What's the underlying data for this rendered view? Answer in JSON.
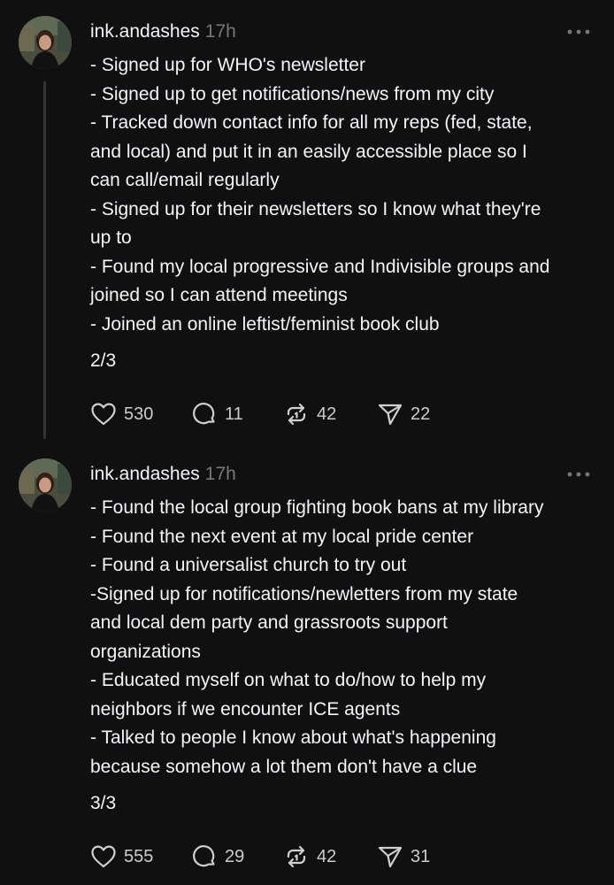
{
  "posts": [
    {
      "username": "ink.andashes",
      "timestamp": "17h",
      "text": "- Signed up for WHO's newsletter\n- Signed up to get notifications/news from my city\n- Tracked down contact info for all my reps (fed, state,\nand local) and put it in an easily accessible place so I\ncan call/email regularly\n- Signed up for their newsletters so I know what they're\nup to\n- Found my local progressive and Indivisible groups and\njoined so I can attend meetings\n- Joined an online leftist/feminist book club",
      "page_count": "2/3",
      "likes": "530",
      "replies": "11",
      "reposts": "42",
      "shares": "22"
    },
    {
      "username": "ink.andashes",
      "timestamp": "17h",
      "text": "- Found the local group fighting book bans at my library\n- Found the next event at my local pride center\n- Found a universalist church to try out\n-Signed up for notifications/newletters from my state\nand local dem party and grassroots support\norganizations\n- Educated myself on what to do/how to help my\nneighbors if we encounter ICE agents\n- Talked to people I know about what's happening\nbecause somehow a lot them don't have a clue",
      "page_count": "3/3",
      "likes": "555",
      "replies": "29",
      "reposts": "42",
      "shares": "31"
    }
  ],
  "icons": {
    "like": "heart-icon",
    "reply": "comment-icon",
    "repost": "repost-icon",
    "share": "send-icon",
    "more": "more-options-icon"
  },
  "colors": {
    "background": "#101010",
    "text": "#f3f5f7",
    "muted": "#777777",
    "thread_line": "#333638"
  }
}
